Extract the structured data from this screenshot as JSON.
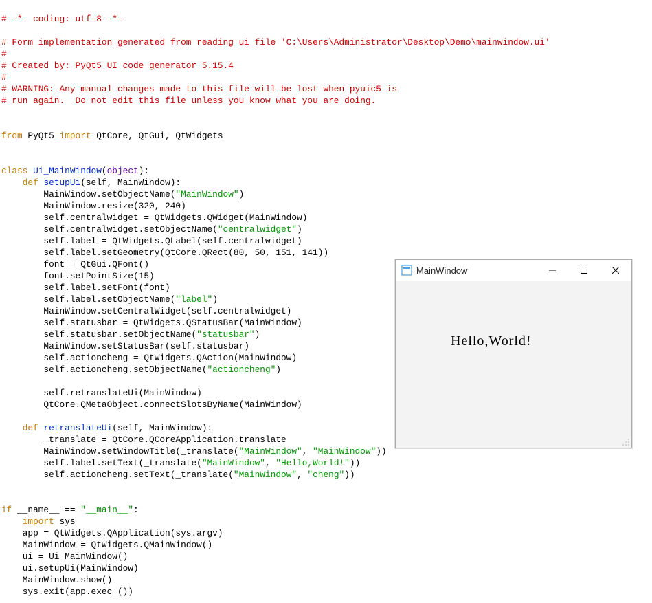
{
  "code": {
    "c1": "# -*- coding: utf-8 -*-",
    "c2": "# Form implementation generated from reading ui file 'C:\\Users\\Administrator\\Desktop\\Demo\\mainwindow.ui'",
    "c3": "#",
    "c4": "# Created by: PyQt5 UI code generator 5.15.4",
    "c5": "#",
    "c6": "# WARNING: Any manual changes made to this file will be lost when pyuic5 is",
    "c7": "# run again.  Do not edit this file unless you know what you are doing.",
    "kw_from": "from",
    "mod_pyqt5": " PyQt5 ",
    "kw_import": "import",
    "imp_rest": " QtCore, QtGui, QtWidgets",
    "kw_class": "class",
    "cls_name": " Ui_MainWindow",
    "cls_paren_open": "(",
    "cls_base": "object",
    "cls_paren_close": "):",
    "kw_def1": "def",
    "fn_setup": " setupUi",
    "fn_setup_args": "(self, MainWindow):",
    "l_setObjectName": "        MainWindow.setObjectName(",
    "s_mainwindow": "\"MainWindow\"",
    "l_close_paren": ")",
    "l_resize": "        MainWindow.resize(320, 240)",
    "l_centralwidget_assign": "        self.centralwidget = QtWidgets.QWidget(MainWindow)",
    "l_centralwidget_setname_a": "        self.centralwidget.setObjectName(",
    "s_centralwidget": "\"centralwidget\"",
    "l_label_assign": "        self.label = QtWidgets.QLabel(self.centralwidget)",
    "l_label_geom": "        self.label.setGeometry(QtCore.QRect(80, 50, 151, 141))",
    "l_font_assign": "        font = QtGui.QFont()",
    "l_font_size": "        font.setPointSize(15)",
    "l_label_setfont": "        self.label.setFont(font)",
    "l_label_setname_a": "        self.label.setObjectName(",
    "s_label": "\"label\"",
    "l_setcentral": "        MainWindow.setCentralWidget(self.centralwidget)",
    "l_statusbar_assign": "        self.statusbar = QtWidgets.QStatusBar(MainWindow)",
    "l_statusbar_setname_a": "        self.statusbar.setObjectName(",
    "s_statusbar": "\"statusbar\"",
    "l_setstatus": "        MainWindow.setStatusBar(self.statusbar)",
    "l_actioncheng_assign": "        self.actioncheng = QtWidgets.QAction(MainWindow)",
    "l_actioncheng_setname_a": "        self.actioncheng.setObjectName(",
    "s_actioncheng": "\"actioncheng\"",
    "l_retranscall": "        self.retranslateUi(MainWindow)",
    "l_connectslots": "        QtCore.QMetaObject.connectSlotsByName(MainWindow)",
    "kw_def2": "def",
    "fn_retrans": " retranslateUi",
    "fn_retrans_args": "(self, MainWindow):",
    "l_translate_assign": "        _translate = QtCore.QCoreApplication.translate",
    "l_setwintitle_a": "        MainWindow.setWindowTitle(_translate(",
    "sep_comma_sp": ", ",
    "l_close_dparen": "))",
    "l_labeltext_a": "        self.label.setText(_translate(",
    "s_hello": "\"Hello,World!\"",
    "l_actiontext_a": "        self.actioncheng.setText(_translate(",
    "s_cheng": "\"cheng\"",
    "kw_if": "if",
    "main_cond_a": " __name__ == ",
    "s_main": "\"__main__\"",
    "main_colon": ":",
    "kw_import2": "import",
    "imp_sys": " sys",
    "l_app": "    app = QtWidgets.QApplication(sys.argv)",
    "l_mainwin": "    MainWindow = QtWidgets.QMainWindow()",
    "l_ui": "    ui = Ui_MainWindow()",
    "l_ui_setup": "    ui.setupUi(MainWindow)",
    "l_show": "    MainWindow.show()",
    "l_exit": "    sys.exit(app.exec_())"
  },
  "overlay": {
    "title": "MainWindow",
    "label_text": "Hello,World!"
  }
}
